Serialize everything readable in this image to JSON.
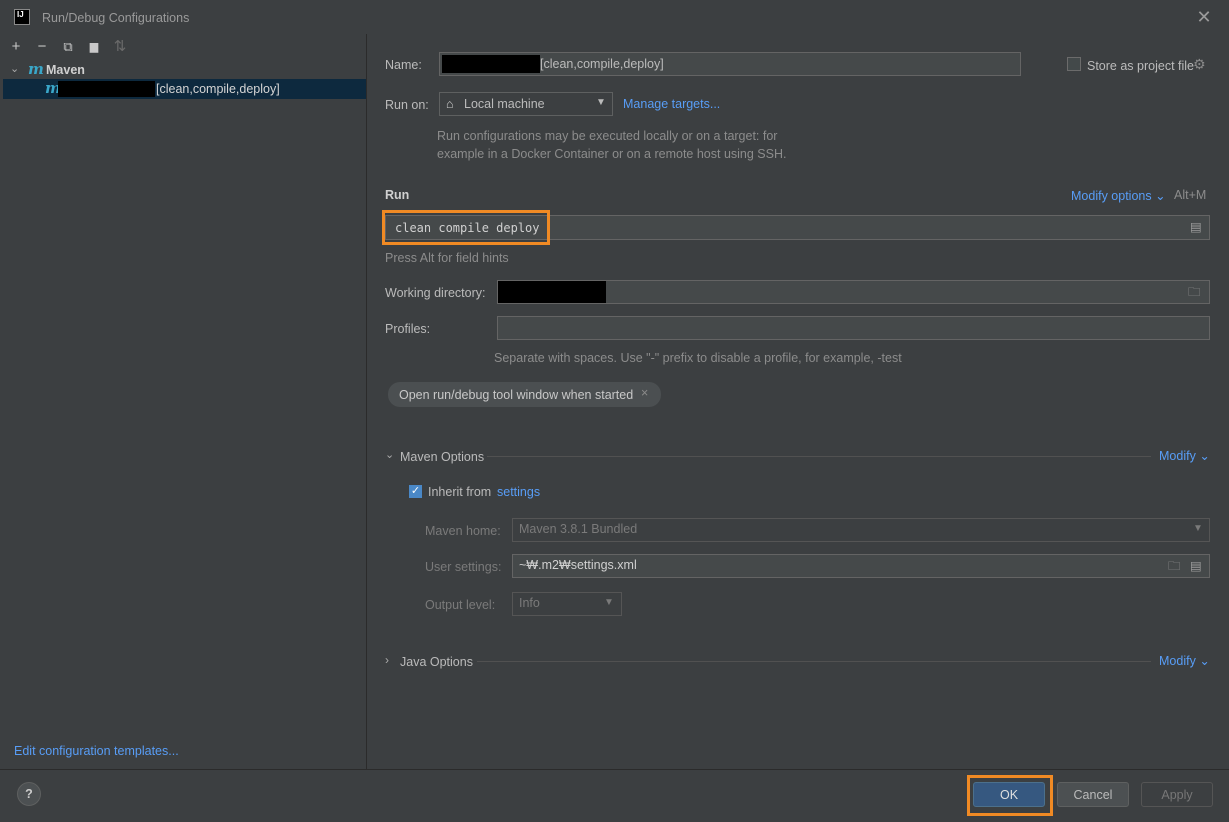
{
  "window": {
    "title": "Run/Debug Configurations",
    "app_icon_text": "IJ"
  },
  "toolbar": {
    "add_icon": "+",
    "remove_icon": "−",
    "copy_icon": "⧉",
    "folder_icon": "▆",
    "sort_icon": "⇅"
  },
  "tree": {
    "group_label": "Maven",
    "group_icon": "m",
    "config_suffix": "[clean,compile,deploy]"
  },
  "left_footer": {
    "edit_templates": "Edit configuration templates..."
  },
  "form": {
    "name_label": "Name:",
    "name_suffix": "[clean,compile,deploy]",
    "store_label": "Store as project file",
    "run_on_label": "Run on:",
    "run_on_value": "Local machine",
    "manage_targets": "Manage targets...",
    "run_on_hint_1": "Run configurations may be executed locally or on a target: for",
    "run_on_hint_2": "example in a Docker Container or on a remote host using SSH.",
    "run_section": "Run",
    "modify_options": "Modify options",
    "modify_shortcut": "Alt+M",
    "command_value": "clean compile deploy",
    "alt_hint": "Press Alt for field hints",
    "working_dir_label": "Working directory:",
    "profiles_label": "Profiles:",
    "profiles_hint": "Separate with spaces. Use \"-\" prefix to disable a profile, for example, -test",
    "chip_label": "Open run/debug tool window when started",
    "chip_close": "×"
  },
  "maven_options": {
    "title": "Maven Options",
    "modify": "Modify",
    "inherit_label": "Inherit from",
    "inherit_link": "settings",
    "maven_home_label": "Maven home:",
    "maven_home_value": "Maven 3.8.1 Bundled",
    "user_settings_label": "User settings:",
    "user_settings_value": "~₩.m2₩settings.xml",
    "output_level_label": "Output level:",
    "output_level_value": "Info"
  },
  "java_options": {
    "title": "Java Options",
    "modify": "Modify"
  },
  "footer": {
    "help": "?",
    "ok": "OK",
    "cancel": "Cancel",
    "apply": "Apply"
  },
  "colors": {
    "accent_link": "#589df6",
    "highlight": "#f08a24",
    "selected_row": "#0d293e"
  }
}
